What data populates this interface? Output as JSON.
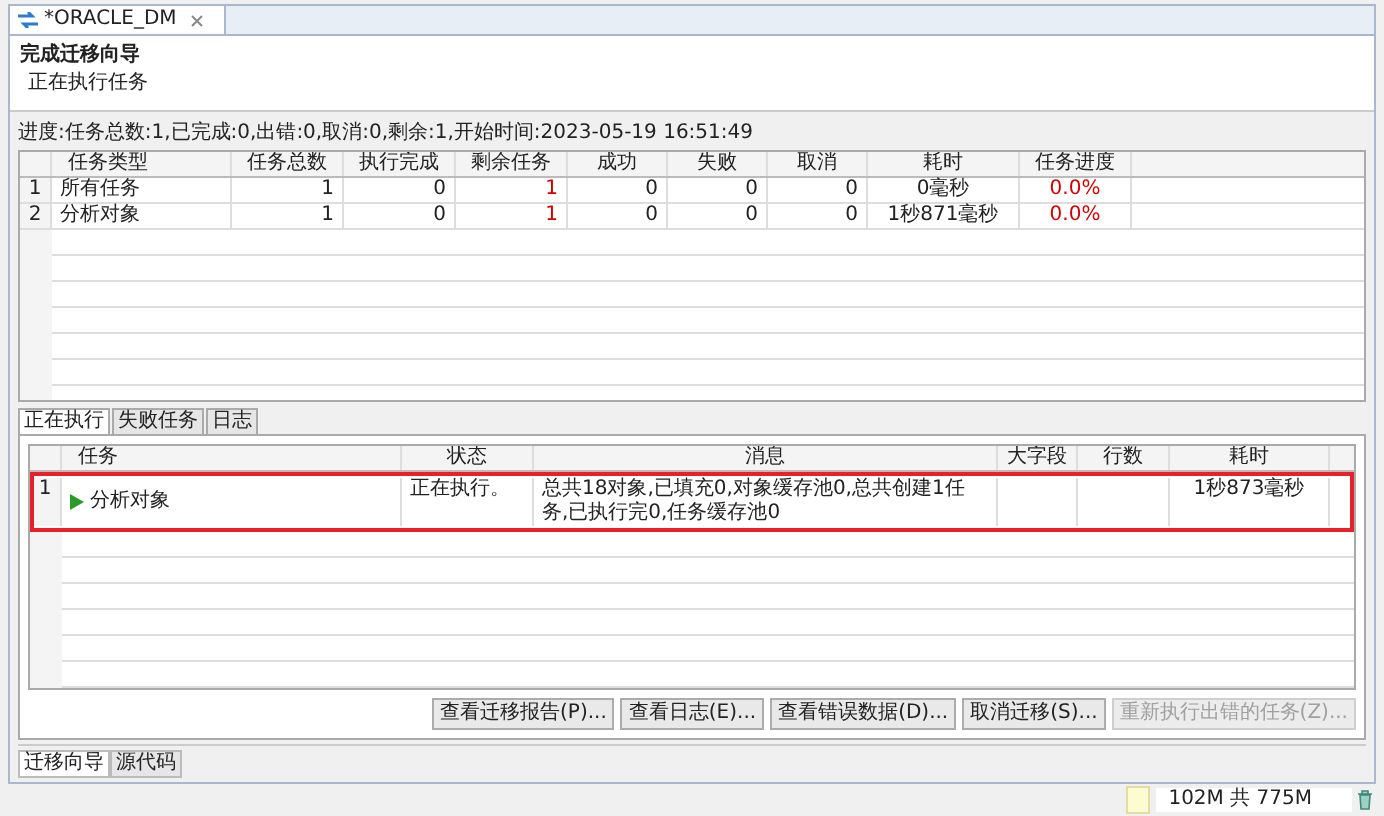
{
  "editor_tab": {
    "title": "*ORACLE_DM"
  },
  "header": {
    "title": "完成迁移向导",
    "subtitle": "正在执行任务"
  },
  "progress": "进度:任务总数:1,已完成:0,出错:0,取消:0,剩余:1,开始时间:2023-05-19 16:51:49",
  "summary_table": {
    "columns": [
      {
        "label": "任务类型",
        "alert": false
      },
      {
        "label": "任务总数",
        "alert": false
      },
      {
        "label": "执行完成",
        "alert": false
      },
      {
        "label": "剩余任务",
        "alert": true
      },
      {
        "label": "成功",
        "alert": false
      },
      {
        "label": "失败",
        "alert": false
      },
      {
        "label": "取消",
        "alert": false
      },
      {
        "label": "耗时",
        "alert": false
      },
      {
        "label": "任务进度",
        "alert": true
      }
    ],
    "rows": [
      {
        "index": "1",
        "cells": [
          "所有任务",
          "1",
          "0",
          "1",
          "0",
          "0",
          "0",
          "0毫秒",
          "0.0%"
        ]
      },
      {
        "index": "2",
        "cells": [
          "分析对象",
          "1",
          "0",
          "1",
          "0",
          "0",
          "0",
          "1秒871毫秒",
          "0.0%"
        ]
      }
    ]
  },
  "log_tabs": [
    {
      "label": "正在执行",
      "selected": true
    },
    {
      "label": "失败任务",
      "selected": false
    },
    {
      "label": "日志",
      "selected": false
    }
  ],
  "running_table": {
    "columns": [
      "任务",
      "状态",
      "消息",
      "大字段",
      "行数",
      "耗时"
    ],
    "rows": [
      {
        "index": "1",
        "running": true,
        "highlighted": true,
        "cells": [
          "分析对象",
          "正在执行。",
          "总共18对象,已填充0,对象缓存池0,总共创建1任务,已执行完0,任务缓存池0",
          "",
          "",
          "1秒873毫秒"
        ]
      }
    ]
  },
  "buttons": [
    {
      "label": "查看迁移报告(P)...",
      "disabled": false
    },
    {
      "label": "查看日志(E)...",
      "disabled": false
    },
    {
      "label": "查看错误数据(D)...",
      "disabled": false
    },
    {
      "label": "取消迁移(S)...",
      "disabled": false
    },
    {
      "label": "重新执行出错的任务(Z)...",
      "disabled": true
    }
  ],
  "bottom_tabs": [
    {
      "label": "迁移向导",
      "selected": true
    },
    {
      "label": "源代码",
      "selected": false
    }
  ],
  "status_bar": {
    "memory": "102M 共 775M"
  }
}
